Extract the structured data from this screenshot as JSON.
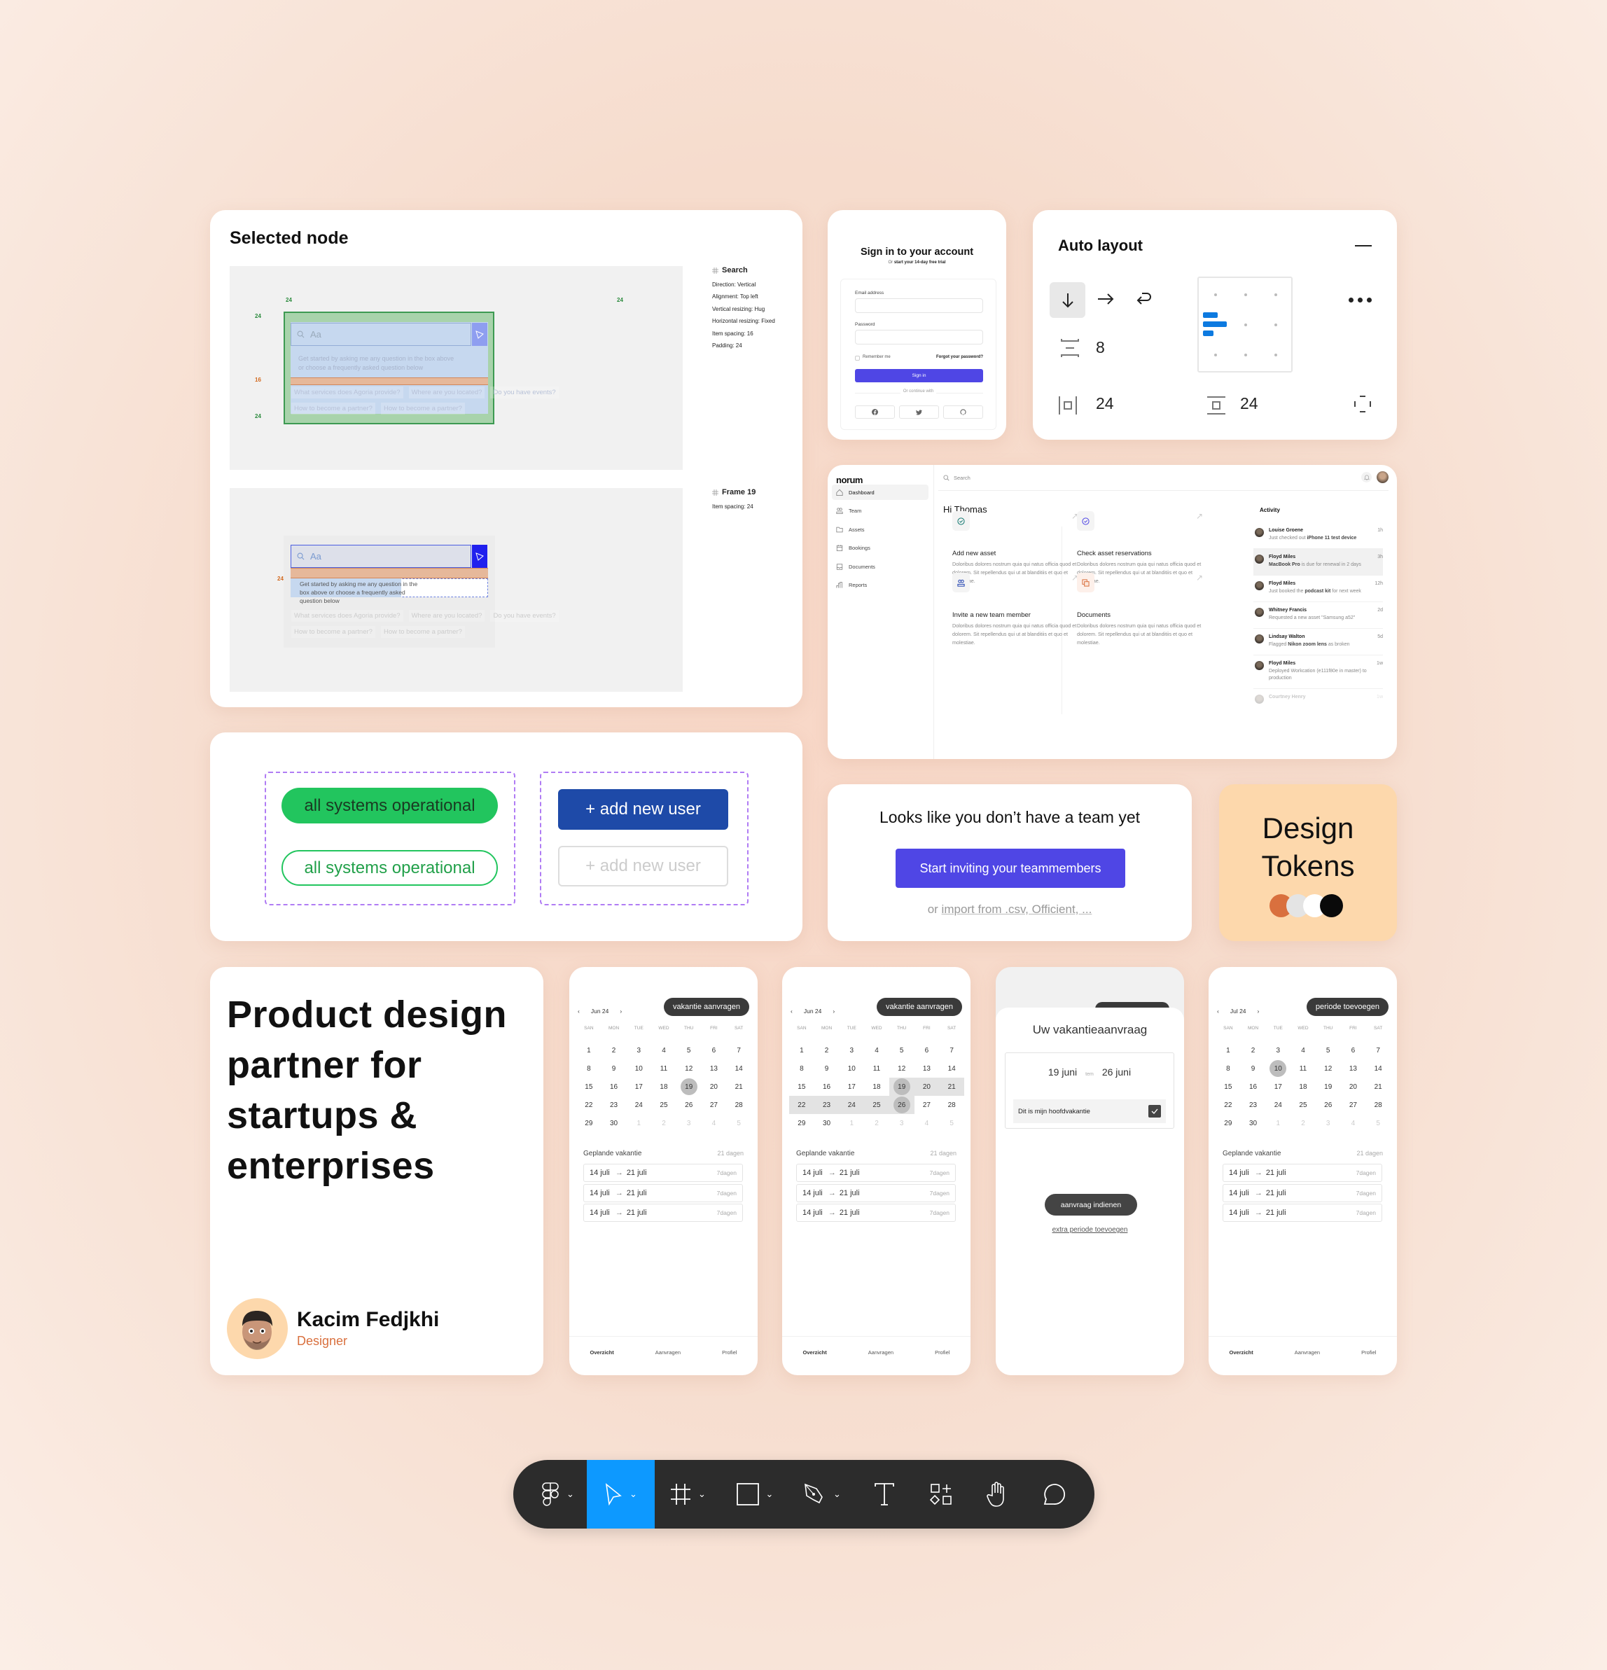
{
  "selected_node": {
    "title": "Selected node",
    "panel1": {
      "heading": "Search",
      "props": [
        "Direction: Vertical",
        "Alignment: Top left",
        "Vertical resizing: Hug",
        "Horizontal resizing: Fixed",
        "Item spacing: 16",
        "Padding: 24"
      ],
      "dims": {
        "left": "24",
        "right": "24",
        "top": "24",
        "gap": "16",
        "bottom": "24"
      },
      "input_placeholder": "Aa",
      "hint": "Get started by asking me any question in the box above or choose a frequently asked question below",
      "chips_row1": [
        "What services does Agoria provide?",
        "Where are you located?",
        "Do you have events?"
      ],
      "chips_row2": [
        "How to become a partner?",
        "How to become a partner?"
      ]
    },
    "panel2": {
      "heading": "Frame 19",
      "props": [
        "Item spacing: 24"
      ],
      "dims": {
        "gap": "24"
      },
      "input_placeholder": "Aa",
      "hint": "Get started by asking me any question in the box above or choose a frequently asked question below",
      "chips_row1": [
        "What services does Agoria provide?",
        "Where are you located?",
        "Do you have events?"
      ],
      "chips_row2": [
        "How to become a partner?",
        "How to become a partner?"
      ]
    }
  },
  "signin": {
    "title": "Sign in to your account",
    "subtitle_prefix": "Or ",
    "subtitle_link": "start your 14-day free trial",
    "email_label": "Email address",
    "password_label": "Password",
    "remember": "Remember me",
    "forgot": "Forgot your password?",
    "button": "Sign in",
    "divider": "Or continue with",
    "social": [
      "facebook-icon",
      "twitter-icon",
      "github-icon"
    ]
  },
  "auto_layout": {
    "title": "Auto layout",
    "spacing": "8",
    "horizontal_padding": "24",
    "vertical_padding": "24",
    "direction_selected": "vertical"
  },
  "dashboard": {
    "logo": "norum",
    "search_placeholder": "Search",
    "greeting": "Hi Thomas",
    "nav": [
      {
        "label": "Dashboard",
        "icon": "home-icon",
        "active": true
      },
      {
        "label": "Team",
        "icon": "users-icon"
      },
      {
        "label": "Assets",
        "icon": "folder-icon"
      },
      {
        "label": "Bookings",
        "icon": "calendar-icon"
      },
      {
        "label": "Documents",
        "icon": "inbox-icon"
      },
      {
        "label": "Reports",
        "icon": "chart-icon"
      }
    ],
    "tiles": [
      {
        "title": "Add new asset",
        "desc": "Doloribus dolores nostrum quia qui natus officia quod et dolorem. Sit repellendus qui ut at blanditiis et quo et molestiae.",
        "color": "#0f766e"
      },
      {
        "title": "Check asset reservations",
        "desc": "Doloribus dolores nostrum quia qui natus officia quod et dolorem. Sit repellendus qui ut at blanditiis et quo et molestiae.",
        "color": "#4f46e5"
      },
      {
        "title": "Invite a new team member",
        "desc": "Doloribus dolores nostrum quia qui natus officia quod et dolorem. Sit repellendus qui ut at blanditiis et quo et molestiae.",
        "color": "#1e40af"
      },
      {
        "title": "Documents",
        "desc": "Doloribus dolores nostrum quia qui natus officia quod et dolorem. Sit repellendus qui ut at blanditiis et quo et molestiae.",
        "color": "#d9703e"
      }
    ],
    "activity_title": "Activity",
    "activity": [
      {
        "name": "Louise Groene",
        "time": "1h",
        "pre": "Just checked out ",
        "bold": "iPhone 11 test device",
        "post": ""
      },
      {
        "name": "Floyd Miles",
        "time": "3h",
        "pre": "",
        "bold": "MacBook Pro",
        "post": " is due for renewal in 2 days",
        "highlight": true
      },
      {
        "name": "Floyd Miles",
        "time": "12h",
        "pre": "Just booked the ",
        "bold": "podcast kit",
        "post": " for next week"
      },
      {
        "name": "Whitney Francis",
        "time": "2d",
        "pre": "Requested a new asset \"Samsung a52\"",
        "bold": "",
        "post": ""
      },
      {
        "name": "Lindsay Walton",
        "time": "5d",
        "pre": "Flagged ",
        "bold": "Nikon zoom lens",
        "post": " as broken"
      },
      {
        "name": "Floyd Miles",
        "time": "1w",
        "pre": "Deployed Workcation (e111f80e in master) to production",
        "bold": "",
        "post": ""
      },
      {
        "name": "Courtney Henry",
        "time": "1w",
        "pre": "",
        "bold": "",
        "post": ""
      }
    ]
  },
  "badges": {
    "status_filled": "all systems operational",
    "status_outline": "all systems operational",
    "add_user_primary": "+ add new user",
    "add_user_disabled": "+ add new user",
    "green": "#22c55e",
    "blue": "#1e4aa8"
  },
  "team": {
    "title": "Looks like you don’t have a team yet",
    "button": "Start inviting your teammembers",
    "import_prefix": "or ",
    "import_link": "import from .csv, Officient, ..."
  },
  "tokens": {
    "title_line1": "Design",
    "title_line2": "Tokens",
    "swatches": [
      "#d9703e",
      "#e4e4e4",
      "#ffffff",
      "#0a0a0a"
    ]
  },
  "product": {
    "headline": "Product design partner for startups & enterprises",
    "name": "Kacim Fedjkhi",
    "role": "Designer"
  },
  "calendars": [
    {
      "button": "vakantie aanvragen",
      "month": "Jun 24",
      "selected": [
        19
      ],
      "range": []
    },
    {
      "button": "vakantie aanvragen",
      "month": "Jun 24",
      "selected": [
        19,
        26
      ],
      "range": [
        20,
        21,
        22,
        23,
        24,
        25
      ]
    },
    {
      "button": "periode toevoegen",
      "month": "Jul 24",
      "selected": [
        10
      ],
      "range": []
    }
  ],
  "calendar_common": {
    "weekdays": [
      "SAN",
      "MON",
      "TUE",
      "WED",
      "THU",
      "FRI",
      "SAT"
    ],
    "days": [
      1,
      2,
      3,
      4,
      5,
      6,
      7,
      8,
      9,
      10,
      11,
      12,
      13,
      14,
      15,
      16,
      17,
      18,
      19,
      20,
      21,
      22,
      23,
      24,
      25,
      26,
      27,
      28,
      29,
      30
    ],
    "trailing": [
      1,
      2,
      3,
      4,
      5
    ],
    "planned_label": "Geplande vakantie",
    "planned_total": "21 dagen",
    "rows": [
      {
        "from": "14 juli",
        "to": "21 juli",
        "days": "7dagen"
      },
      {
        "from": "14 juli",
        "to": "21 juli",
        "days": "7dagen"
      },
      {
        "from": "14 juli",
        "to": "21 juli",
        "days": "7dagen"
      }
    ],
    "tabs": [
      "Overzicht",
      "Aanvragen",
      "Profiel"
    ]
  },
  "request": {
    "title": "Uw vakantieaanvraag",
    "from": "19 juni",
    "sep": "tem",
    "to": "26 juni",
    "checkbox_label": "Dit is mijn hoofdvakantie",
    "checked": true,
    "submit": "aanvraag indienen",
    "extra": "extra periode toevoegen"
  },
  "toolbar": {
    "tools": [
      "main-menu",
      "move",
      "frame",
      "rectangle",
      "pen",
      "text",
      "resources",
      "hand",
      "comment"
    ],
    "active": "move",
    "active_color": "#0d99ff"
  }
}
